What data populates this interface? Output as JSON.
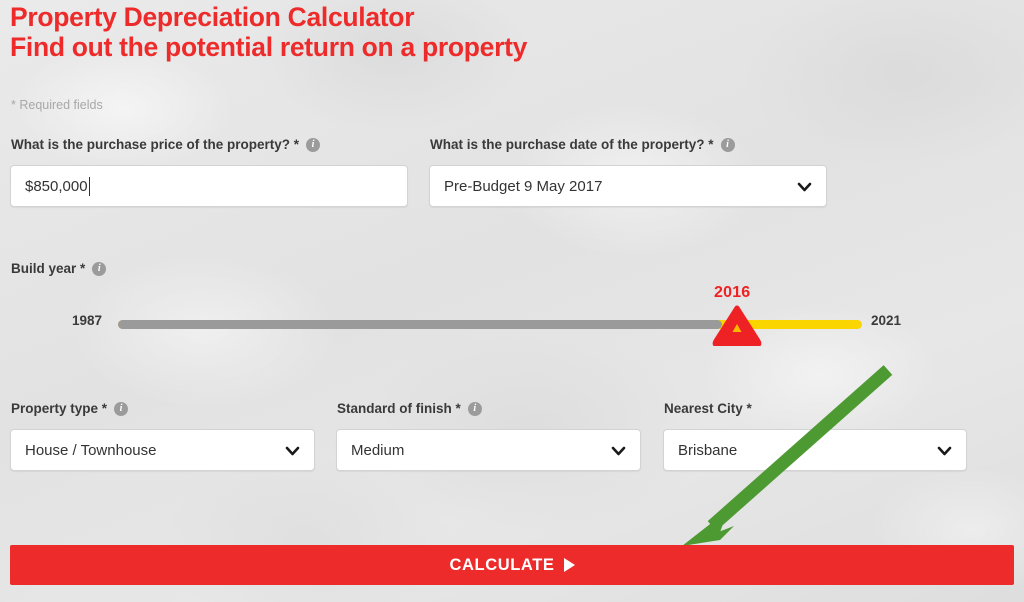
{
  "heading": {
    "line1": "Property Depreciation Calculator",
    "line2": "Find out the potential return on a property",
    "color": "#ee2b2b"
  },
  "required_note": "* Required fields",
  "form": {
    "purchase_price": {
      "label": "What is the purchase price of the property? *",
      "info_icon": "info-icon",
      "value": "$850,000",
      "placeholder": "$850,000",
      "focused": true
    },
    "purchase_date": {
      "label": "What is the purchase date of the property? *",
      "info_icon": "info-icon",
      "value": "Pre-Budget 9 May 2017",
      "caret_icon": "chevron-down-icon"
    },
    "build_year": {
      "label": "Build year *",
      "info_icon": "info-icon",
      "min": "1987",
      "max": "2021",
      "value": "2016",
      "fill_color": "#9a9a9a",
      "remainder_color": "#fbd500",
      "handle_color": "#ee2224",
      "handle_inner_color": "#fbb800"
    },
    "property_type": {
      "label": "Property type *",
      "info_icon": "info-icon",
      "value": "House / Townhouse",
      "caret_icon": "chevron-down-icon"
    },
    "standard_of_finish": {
      "label": "Standard of finish *",
      "info_icon": "info-icon",
      "value": "Medium",
      "caret_icon": "chevron-down-icon"
    },
    "nearest_city": {
      "label": "Nearest City *",
      "value": "Brisbane",
      "caret_icon": "chevron-down-icon"
    }
  },
  "calculate_button": {
    "label": "CALCULATE",
    "icon": "play-triangle-icon",
    "color": "#ee2b2b"
  },
  "annotation": {
    "arrow_icon": "green-arrow-icon",
    "color": "#4e9a32",
    "points_to": "CALCULATE"
  }
}
